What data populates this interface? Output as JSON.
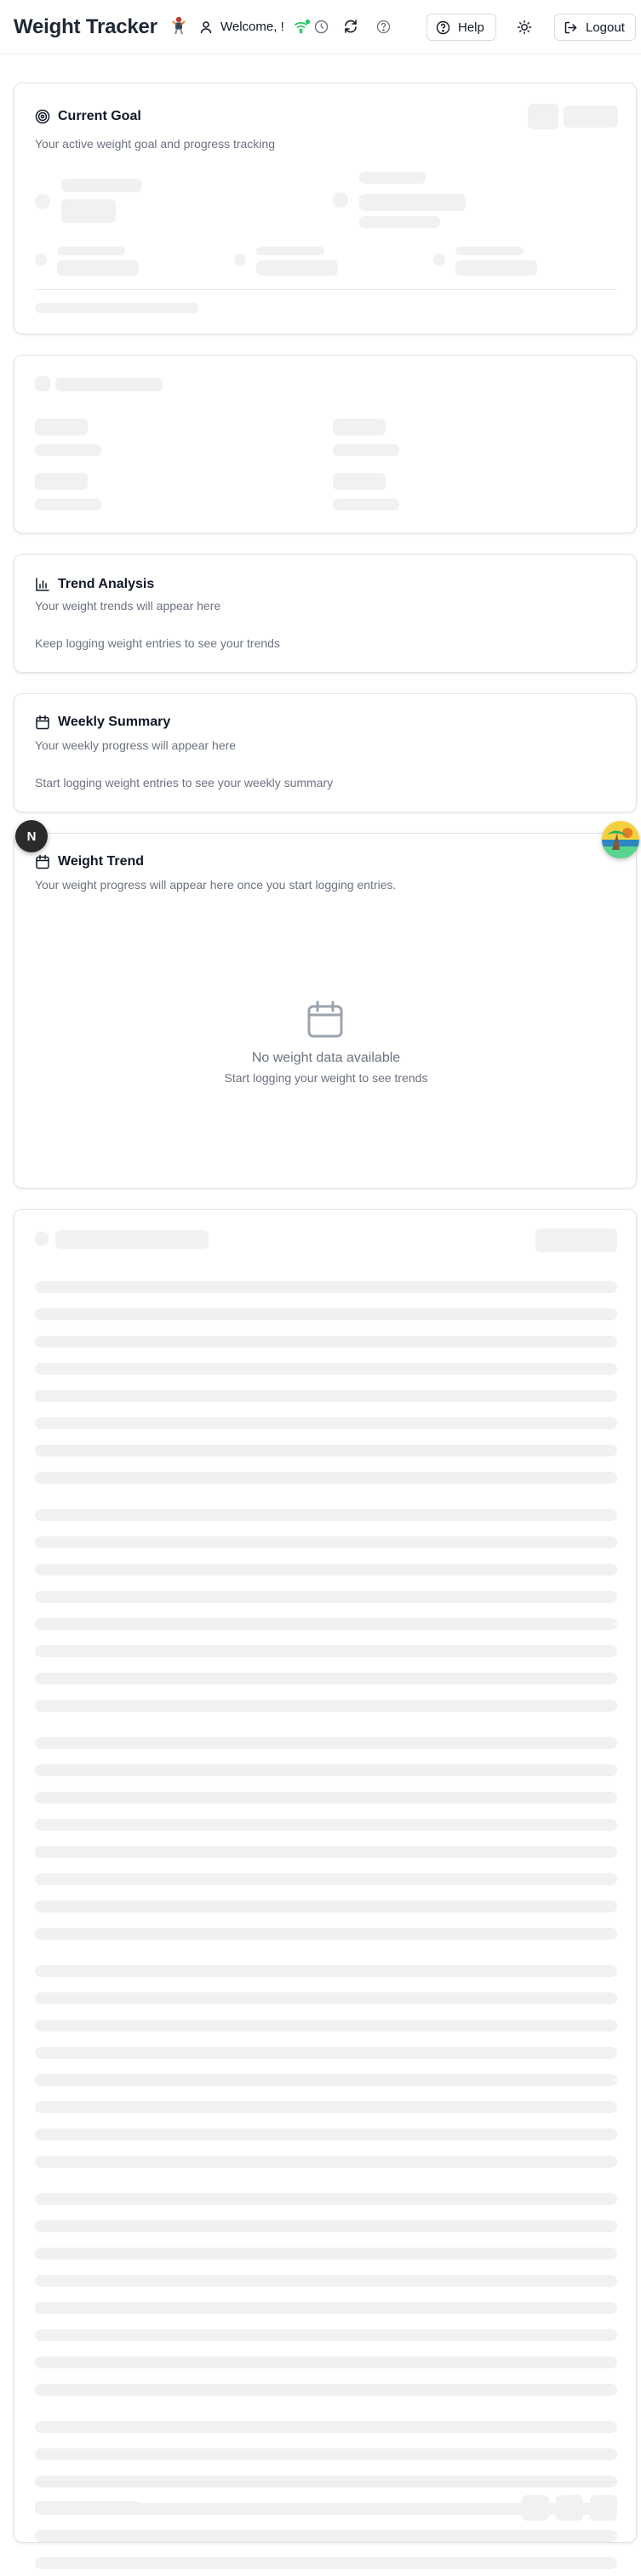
{
  "header": {
    "app_title": "Weight Tracker",
    "welcome": "Welcome, !",
    "help_label": "Help",
    "logout_label": "Logout",
    "status_color": "#22c55e"
  },
  "current_goal": {
    "title": "Current Goal",
    "subtitle": "Your active weight goal and progress tracking"
  },
  "trend_analysis": {
    "title": "Trend Analysis",
    "subtitle": "Your weight trends will appear here",
    "note": "Keep logging weight entries to see your trends"
  },
  "weekly_summary": {
    "title": "Weekly Summary",
    "subtitle": "Your weekly progress will appear here",
    "note": "Start logging weight entries to see your weekly summary"
  },
  "weight_trend": {
    "title": "Weight Trend",
    "subtitle": "Your weight progress will appear here once you start logging entries.",
    "empty_title": "No weight data available",
    "empty_sub": "Start logging your weight to see trends"
  },
  "next_badge": "N",
  "colors": {
    "skeleton": "#f1f1f2",
    "muted_text": "#6b7280",
    "border": "#e3e3e3"
  }
}
